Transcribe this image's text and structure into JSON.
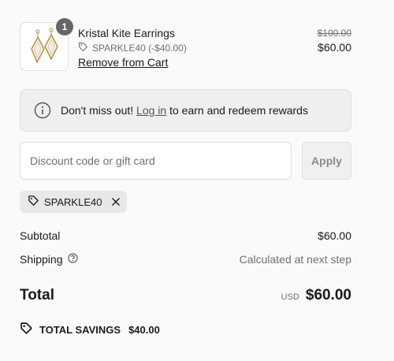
{
  "line_item": {
    "quantity": "1",
    "name": "Kristal Kite Earrings",
    "discount_code": "SPARKLE40 (-$40.00)",
    "remove_label": "Remove from Cart",
    "original_price": "$100.00",
    "price": "$60.00",
    "image_icon": "kite-earrings-image"
  },
  "rewards": {
    "icon": "info-icon",
    "text_before": "Don't miss out!",
    "link_label": "Log in",
    "text_after": "to earn and redeem rewards"
  },
  "discount": {
    "placeholder": "Discount code or gift card",
    "value": "",
    "apply_label": "Apply",
    "applied_code": "SPARKLE40"
  },
  "summary": {
    "subtotal_label": "Subtotal",
    "subtotal_value": "$60.00",
    "shipping_label": "Shipping",
    "shipping_value": "Calculated at next step",
    "total_label": "Total",
    "currency": "USD",
    "total_value": "$60.00",
    "savings_label": "TOTAL SAVINGS",
    "savings_value": "$40.00"
  },
  "colors": {
    "text": "#1a1a1a",
    "muted": "#707070",
    "panel_bg": "#efefef",
    "border": "#dedede",
    "badge": "#666666"
  }
}
